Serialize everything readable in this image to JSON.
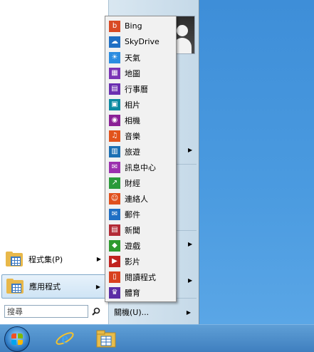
{
  "left_pane": {
    "programs_label": "程式集(P)",
    "apps_label": "應用程式",
    "search_placeholder": "搜尋"
  },
  "right_pane": {
    "shutdown_label": "關機(U)..."
  },
  "apps": [
    {
      "label": "Bing",
      "icon": "bing-icon",
      "color": "#d94a24"
    },
    {
      "label": "SkyDrive",
      "icon": "skydrive-icon",
      "color": "#1f6fc4"
    },
    {
      "label": "天氣",
      "icon": "weather-icon",
      "color": "#2a8ce0"
    },
    {
      "label": "地圖",
      "icon": "maps-icon",
      "color": "#7a33b5"
    },
    {
      "label": "行事曆",
      "icon": "calendar-icon",
      "color": "#6a2fb0"
    },
    {
      "label": "相片",
      "icon": "photos-icon",
      "color": "#0b8aa1"
    },
    {
      "label": "相機",
      "icon": "camera-icon",
      "color": "#8a2096"
    },
    {
      "label": "音樂",
      "icon": "music-icon",
      "color": "#e2531b"
    },
    {
      "label": "旅遊",
      "icon": "travel-icon",
      "color": "#1b6fb3"
    },
    {
      "label": "訊息中心",
      "icon": "messaging-icon",
      "color": "#9b2fae"
    },
    {
      "label": "財經",
      "icon": "finance-icon",
      "color": "#2a9a3a"
    },
    {
      "label": "連絡人",
      "icon": "people-icon",
      "color": "#e0501c"
    },
    {
      "label": "郵件",
      "icon": "mail-icon",
      "color": "#1f6fc4"
    },
    {
      "label": "新聞",
      "icon": "news-icon",
      "color": "#b22a36"
    },
    {
      "label": "遊戲",
      "icon": "games-icon",
      "color": "#2e9a2e"
    },
    {
      "label": "影片",
      "icon": "video-icon",
      "color": "#c1221f"
    },
    {
      "label": "閱讀程式",
      "icon": "reader-icon",
      "color": "#d8401e"
    },
    {
      "label": "體育",
      "icon": "sports-icon",
      "color": "#5a2da5"
    }
  ]
}
